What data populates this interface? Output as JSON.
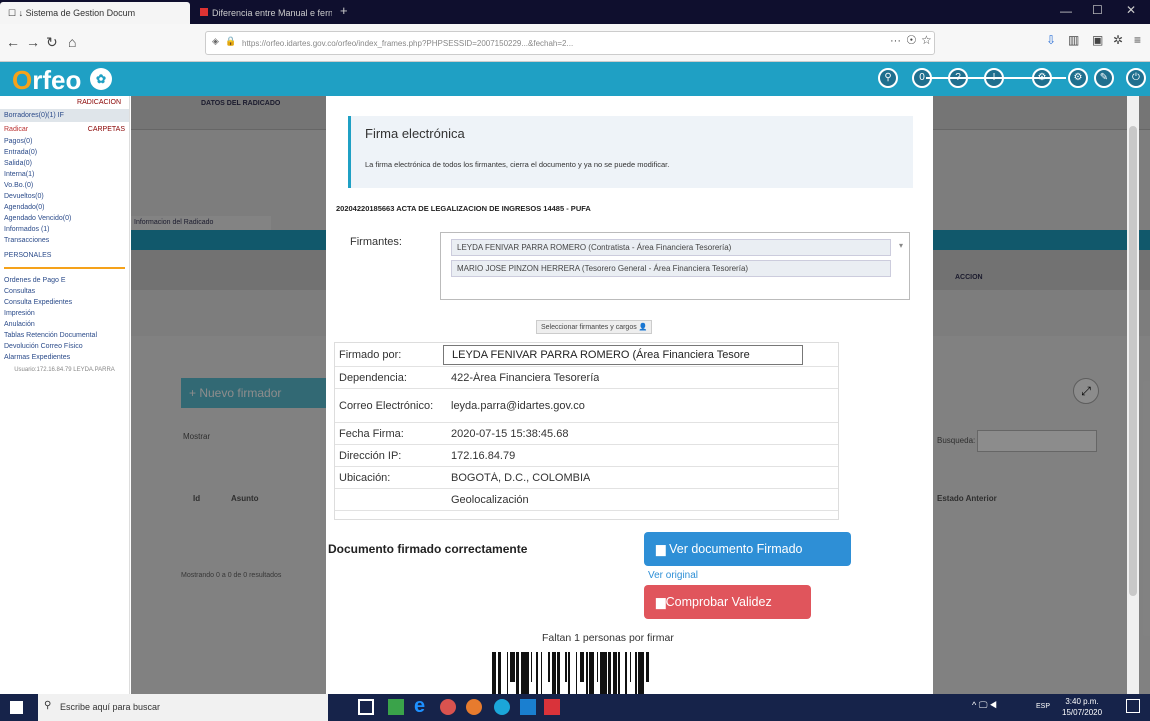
{
  "browser": {
    "tab1_title": "☐ ↓ Sistema de Gestion Docum",
    "tab2_title": "Diferencia entre Manual e fern",
    "url": "https://orfeo.idartes.gov.co/orfeo/index_frames.php?PHPSESSID=2007150229...&fechah=2...",
    "icons": [
      "back-icon",
      "forward-icon",
      "reload-icon",
      "home-icon"
    ]
  },
  "app": {
    "logo_letter": "O",
    "logo_text": "rfeo"
  },
  "sidebar": {
    "header": "RADICACION",
    "selected": "Borradores(0)(1) IF",
    "actions_left": "Radicar",
    "actions_right": "CARPETAS",
    "items": [
      "Pagos(0)",
      "Entrada(0)",
      "Salida(0)",
      "Interna(1)",
      "Vo.Bo.(0)",
      "Devueltos(0)",
      "Agendado(0)",
      "Agendado Vencido(0)",
      "Informados (1)",
      "Transacciones"
    ],
    "personal": "PERSONALES",
    "links": [
      "Ordenes de Pago E",
      "Consultas",
      "Consulta Expedientes",
      "Impresión",
      "Anulación",
      "Tablas Retención Documental",
      "Devolución Correo Físico",
      "Alarmas Expedientes"
    ],
    "footer": "Usuario:172.16.84.79 LEYDA.PARRA"
  },
  "background": {
    "radicado_header": "DATOS DEL RADICADO",
    "tab_info": "Informacion del Radicado",
    "nuevo_firmador": "Nuevo firmador",
    "mostrar": "Mostrar",
    "col_id": "Id",
    "col_asunto": "Asunto",
    "mostrando": "Mostrando 0 a 0 de 0 resultados",
    "accion": "ACCION",
    "buscar": "Busqueda:",
    "estado_anterior": "Estado Anterior"
  },
  "modal": {
    "title": "Firma electrónica",
    "notice": "La firma electrónica de todos los firmantes, cierra el documento y ya no se puede modificar.",
    "doc_title": "20204220185663 ACTA DE LEGALIZACION DE INGRESOS 14485 - PUFA",
    "firmantes_label": "Firmantes:",
    "firmantes": [
      "LEYDA FENIVAR PARRA ROMERO (Contratista - Área Financiera Tesorería)",
      "MARIO JOSE PINZON HERRERA (Tesorero General - Área Financiera Tesorería)"
    ],
    "select_button": "Seleccionar firmantes y cargos",
    "fields": [
      {
        "label": "Firmado por:",
        "value": "LEYDA FENIVAR PARRA ROMERO (Área Financiera Tesore"
      },
      {
        "label": "Dependencia:",
        "value": "422-Área Financiera Tesorería"
      },
      {
        "label": "Correo Electrónico:",
        "value": "leyda.parra@idartes.gov.co"
      },
      {
        "label": "Fecha Firma:",
        "value": "2020-07-15 15:38:45.68"
      },
      {
        "label": "Dirección IP:",
        "value": "172.16.84.79"
      },
      {
        "label": "Ubicación:",
        "value": "BOGOTÁ, D.C., COLOMBIA"
      },
      {
        "label": "",
        "value": "Geolocalización"
      }
    ],
    "success": "Documento firmado correctamente",
    "ver_firmado": "Ver documento Firmado",
    "ver_original": "Ver original",
    "comprobar": "Comprobar Validez",
    "faltan": "Faltan 1 personas por firmar"
  },
  "taskbar": {
    "search_placeholder": "Escribe aquí para buscar",
    "time": "3:40 p.m.",
    "date": "15/07/2020",
    "lang": "ESP"
  },
  "colors": {
    "accent": "#1fa0c4",
    "blue_button": "#2e8fd6",
    "red_button": "#e0555c",
    "taskbar": "#16234a"
  }
}
